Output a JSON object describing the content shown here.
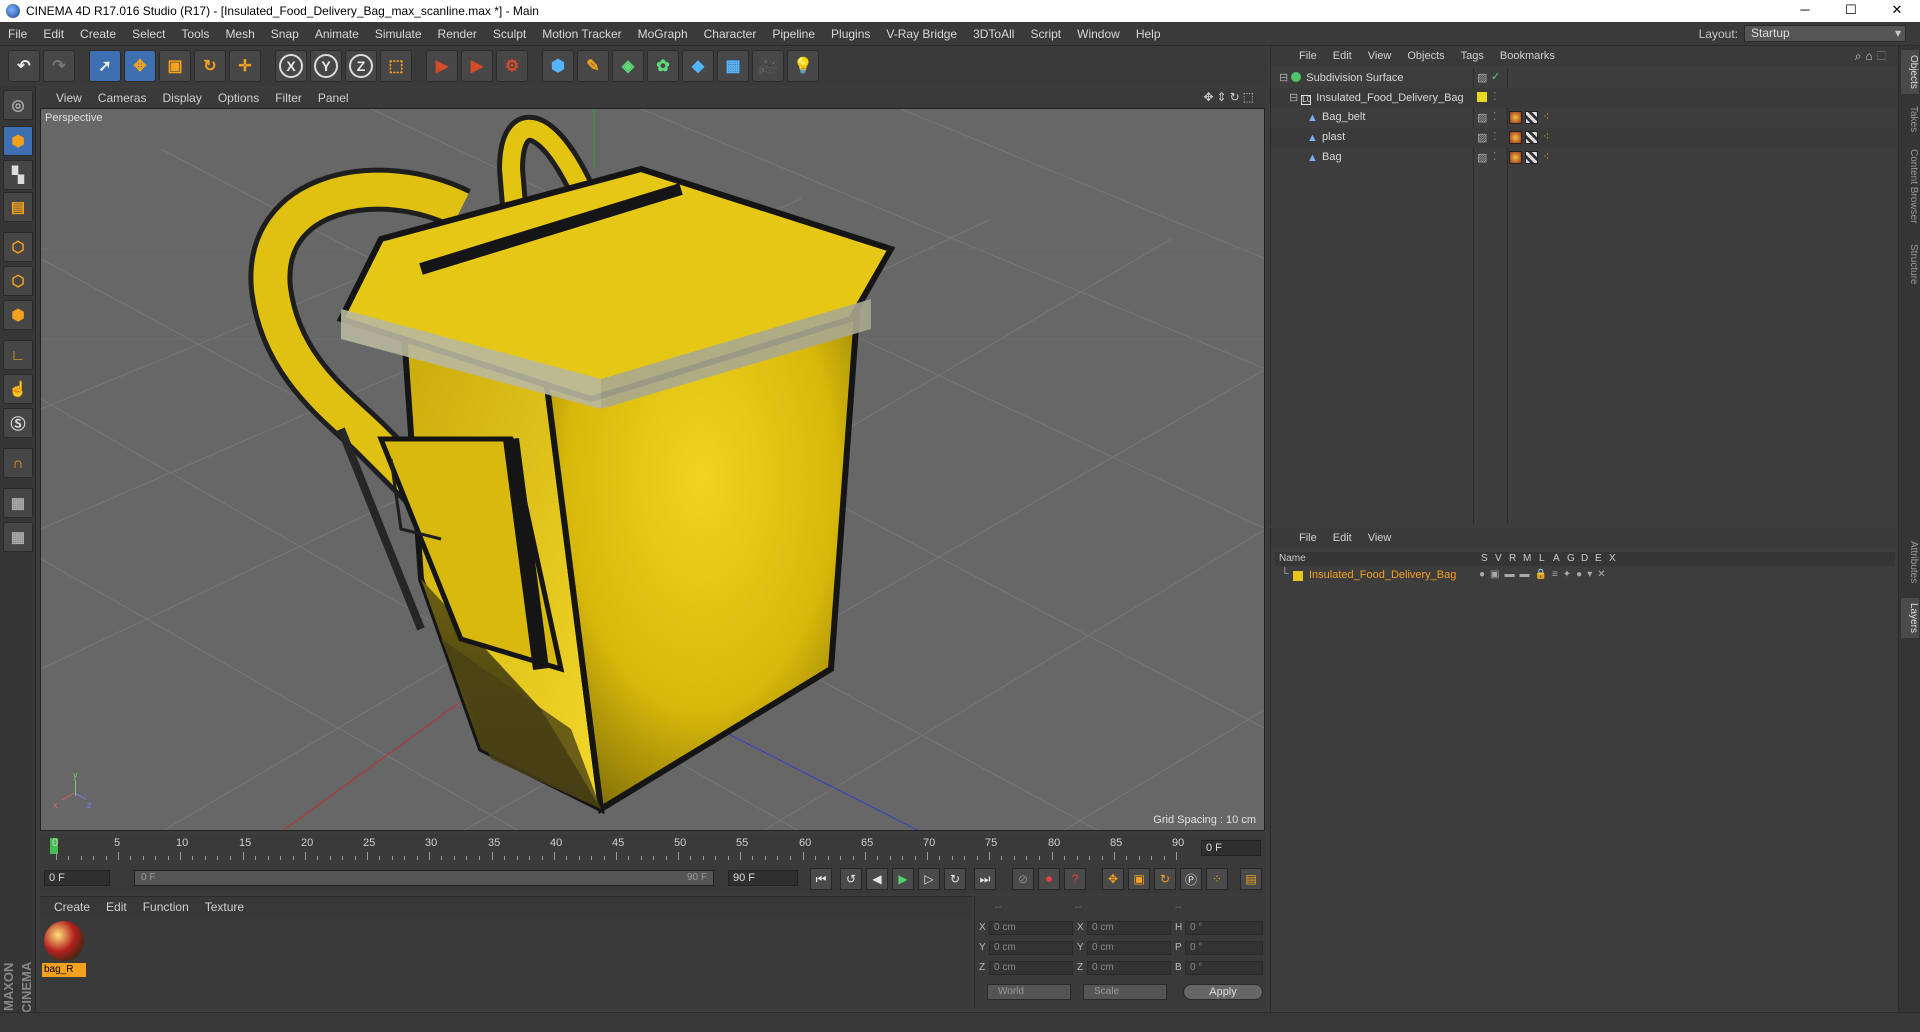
{
  "window": {
    "title": "CINEMA 4D R17.016 Studio (R17) - [Insulated_Food_Delivery_Bag_max_scanline.max *] - Main",
    "minimize": "─",
    "maximize": "☐",
    "close": "✕"
  },
  "menu": [
    "File",
    "Edit",
    "Create",
    "Select",
    "Tools",
    "Mesh",
    "Snap",
    "Animate",
    "Simulate",
    "Render",
    "Sculpt",
    "Motion Tracker",
    "MoGraph",
    "Character",
    "Pipeline",
    "Plugins",
    "V-Ray Bridge",
    "3DToAll",
    "Script",
    "Window",
    "Help"
  ],
  "layout": {
    "label": "Layout:",
    "value": "Startup"
  },
  "viewport": {
    "menu": [
      "View",
      "Cameras",
      "Display",
      "Options",
      "Filter",
      "Panel"
    ],
    "camera_label": "Perspective",
    "grid_spacing": "Grid Spacing : 10 cm",
    "axis_x": "x",
    "axis_y": "y",
    "axis_z": "z"
  },
  "timeline": {
    "ticks": [
      "0",
      "5",
      "10",
      "15",
      "20",
      "25",
      "30",
      "35",
      "40",
      "45",
      "50",
      "55",
      "60",
      "65",
      "70",
      "75",
      "80",
      "85",
      "90"
    ],
    "current_frame": "0 F",
    "start": "0 F",
    "slider_start": "0 F",
    "slider_end": "90 F",
    "end": "90 F"
  },
  "material_manager": {
    "menu": [
      "Create",
      "Edit",
      "Function",
      "Texture"
    ],
    "materials": [
      {
        "name": "bag_R"
      }
    ]
  },
  "coordinates": {
    "headers": [
      "--",
      "--",
      "--"
    ],
    "rows": [
      {
        "l1": "X",
        "v1": "0 cm",
        "l2": "X",
        "v2": "0 cm",
        "l3": "H",
        "v3": "0 °"
      },
      {
        "l1": "Y",
        "v1": "0 cm",
        "l2": "Y",
        "v2": "0 cm",
        "l3": "P",
        "v3": "0 °"
      },
      {
        "l1": "Z",
        "v1": "0 cm",
        "l2": "Z",
        "v2": "0 cm",
        "l3": "B",
        "v3": "0 °"
      }
    ],
    "mode_world": "World",
    "mode_scale": "Scale",
    "apply": "Apply"
  },
  "object_manager": {
    "menu": [
      "File",
      "Edit",
      "View",
      "Objects",
      "Tags",
      "Bookmarks"
    ],
    "objects": [
      {
        "name": "Subdivision Surface",
        "indent": 0
      },
      {
        "name": "Insulated_Food_Delivery_Bag",
        "indent": 1
      },
      {
        "name": "Bag_belt",
        "indent": 2
      },
      {
        "name": "plast",
        "indent": 2
      },
      {
        "name": "Bag",
        "indent": 2
      }
    ]
  },
  "layer_manager": {
    "menu": [
      "File",
      "Edit",
      "View"
    ],
    "columns": [
      "Name",
      "S",
      "V",
      "R",
      "M",
      "L",
      "A",
      "G",
      "D",
      "E",
      "X"
    ],
    "layers": [
      {
        "name": "Insulated_Food_Delivery_Bag",
        "color": "#e8c318"
      }
    ]
  },
  "right_tabs": [
    "Objects",
    "Takes",
    "Content Browser",
    "Structure",
    "Attributes",
    "Layers"
  ],
  "brand": "MAXON CINEMA 4D",
  "colors": {
    "accent": "#f4a11e",
    "bag_yellow": "#e8c318",
    "selected_blue": "#3d6fb1"
  }
}
